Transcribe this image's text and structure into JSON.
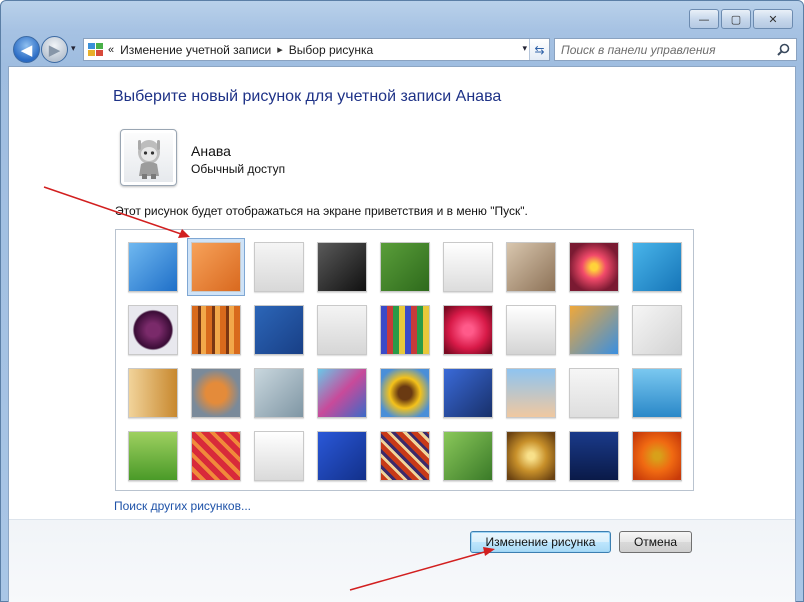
{
  "window": {
    "caption": {
      "minimize": "—",
      "maximize": "▢",
      "close": "✕"
    }
  },
  "nav": {
    "back_icon": "◀",
    "forward_icon": "▶",
    "dropdown_icon": "▾",
    "breadcrumb": [
      "Изменение учетной записи",
      "Выбор рисунка"
    ],
    "breadcrumb_sep_icon": "«",
    "chevron_icon": "▸",
    "refresh_icon": "⇆",
    "search_placeholder": "Поиск в панели управления"
  },
  "page": {
    "heading": "Выберите новый рисунок для учетной записи Анава",
    "account_name": "Анава",
    "account_type": "Обычный доступ",
    "info_text": "Этот рисунок будет отображаться на экране приветствия и в меню \"Пуск\".",
    "more_pictures_link": "Поиск других рисунков...",
    "selected_index": 1,
    "tiles": [
      {
        "name": "ferris-wheel",
        "bg": "linear-gradient(135deg,#6fb8f0,#1f6fc8)"
      },
      {
        "name": "starfish",
        "bg": "linear-gradient(135deg,#f7a25a,#d9691f)"
      },
      {
        "name": "robot-figure",
        "bg": "linear-gradient(180deg,#f5f5f5,#d8d8d8)"
      },
      {
        "name": "record-player",
        "bg": "linear-gradient(135deg,#5a5a5a,#101010)"
      },
      {
        "name": "lucky-cat",
        "bg": "linear-gradient(135deg,#5a9e3a,#2e6a1c)"
      },
      {
        "name": "gyroscope",
        "bg": "linear-gradient(180deg,#ffffff,#dcdcdc)"
      },
      {
        "name": "kitten",
        "bg": "linear-gradient(135deg,#d8c6ae,#8d7257)"
      },
      {
        "name": "flower",
        "bg": "radial-gradient(circle,#ffd23a 10%,#f24a6a 35%,#7a1a32 75%)"
      },
      {
        "name": "pinwheel",
        "bg": "linear-gradient(135deg,#49b5ea,#1675b8)"
      },
      {
        "name": "ball-8",
        "bg": "radial-gradient(circle,#7a2a6a 20%,#3a0c36 55%,#e8e8ee 60%)"
      },
      {
        "name": "fabric",
        "bg": "repeating-linear-gradient(90deg,#d86a1c 0 6px,#7a3612 6px 9px,#f2a84a 9px 14px)"
      },
      {
        "name": "leaf",
        "bg": "linear-gradient(135deg,#2c66b8,#183f86)"
      },
      {
        "name": "dog",
        "bg": "linear-gradient(180deg,#f4f4f4,#d6d6d6)"
      },
      {
        "name": "crayons",
        "bg": "repeating-linear-gradient(90deg,#3a4ac8 0 6px,#c83a3a 6px 12px,#2a9a48 12px 18px,#e8c83a 18px 24px)"
      },
      {
        "name": "star-paper",
        "bg": "radial-gradient(circle,#ff5a8a 15%,#d81a48 55%,#7a0a22 90%)"
      },
      {
        "name": "jacks",
        "bg": "linear-gradient(180deg,#ffffff,#d4d4d4)"
      },
      {
        "name": "stairs",
        "bg": "linear-gradient(135deg,#f0a83a,#3a8fe0)"
      },
      {
        "name": "origami",
        "bg": "linear-gradient(135deg,#f6f6f6,#d3d3d3)"
      },
      {
        "name": "guitar",
        "bg": "linear-gradient(90deg,#f1d39a,#c8882e)"
      },
      {
        "name": "pomeranian",
        "bg": "radial-gradient(circle,#e48b3a 30%,#7a8a9a 70%)"
      },
      {
        "name": "tin-robot",
        "bg": "linear-gradient(135deg,#c9d7de,#7f96a4)"
      },
      {
        "name": "scarf",
        "bg": "linear-gradient(135deg,#6ac8e8,#c84a9a,#3a6ac8)"
      },
      {
        "name": "sunflower",
        "bg": "radial-gradient(circle,#6a3a12 20%,#f4c21a 45%,#4a8fd8 80%)"
      },
      {
        "name": "fish",
        "bg": "linear-gradient(135deg,#3a6ad8,#18306a)"
      },
      {
        "name": "balloon",
        "bg": "linear-gradient(180deg,#8fc4f0,#f0c8a0)"
      },
      {
        "name": "doll",
        "bg": "linear-gradient(180deg,#f6f6f6,#dedede)"
      },
      {
        "name": "sailboat",
        "bg": "linear-gradient(180deg,#7ac8f0,#2a88c8)"
      },
      {
        "name": "soccer-ball",
        "bg": "linear-gradient(180deg,#9ed060,#4a9a28)"
      },
      {
        "name": "red-fabric",
        "bg": "repeating-linear-gradient(45deg,#d82a3a 0 6px,#f08a3a 6px 10px)"
      },
      {
        "name": "marbles",
        "bg": "linear-gradient(180deg,#ffffff,#dadada)"
      },
      {
        "name": "window",
        "bg": "linear-gradient(135deg,#2a58d8,#12308a)"
      },
      {
        "name": "pattern",
        "bg": "repeating-linear-gradient(45deg,#c83a18 0 5px,#f0d49a 5px 8px,#3a2a6a 8px 11px)"
      },
      {
        "name": "butterfly",
        "bg": "linear-gradient(135deg,#8ac85a,#3a7a28)"
      },
      {
        "name": "shell-spiral",
        "bg": "radial-gradient(circle,#f8e08a 10%,#c8902a 45%,#6a4212 90%)"
      },
      {
        "name": "lighthouse",
        "bg": "linear-gradient(180deg,#1a3a8a,#0a1a48)"
      },
      {
        "name": "orange-flower",
        "bg": "radial-gradient(circle,#d8a01a 10%,#f06a12 45%,#c83a0a 90%)"
      }
    ],
    "buttons": {
      "change": "Изменение рисунка",
      "cancel": "Отмена"
    }
  },
  "colors": {
    "heading": "#1e3287",
    "link": "#1e52a8",
    "annotation_arrow": "#d21f1f"
  }
}
